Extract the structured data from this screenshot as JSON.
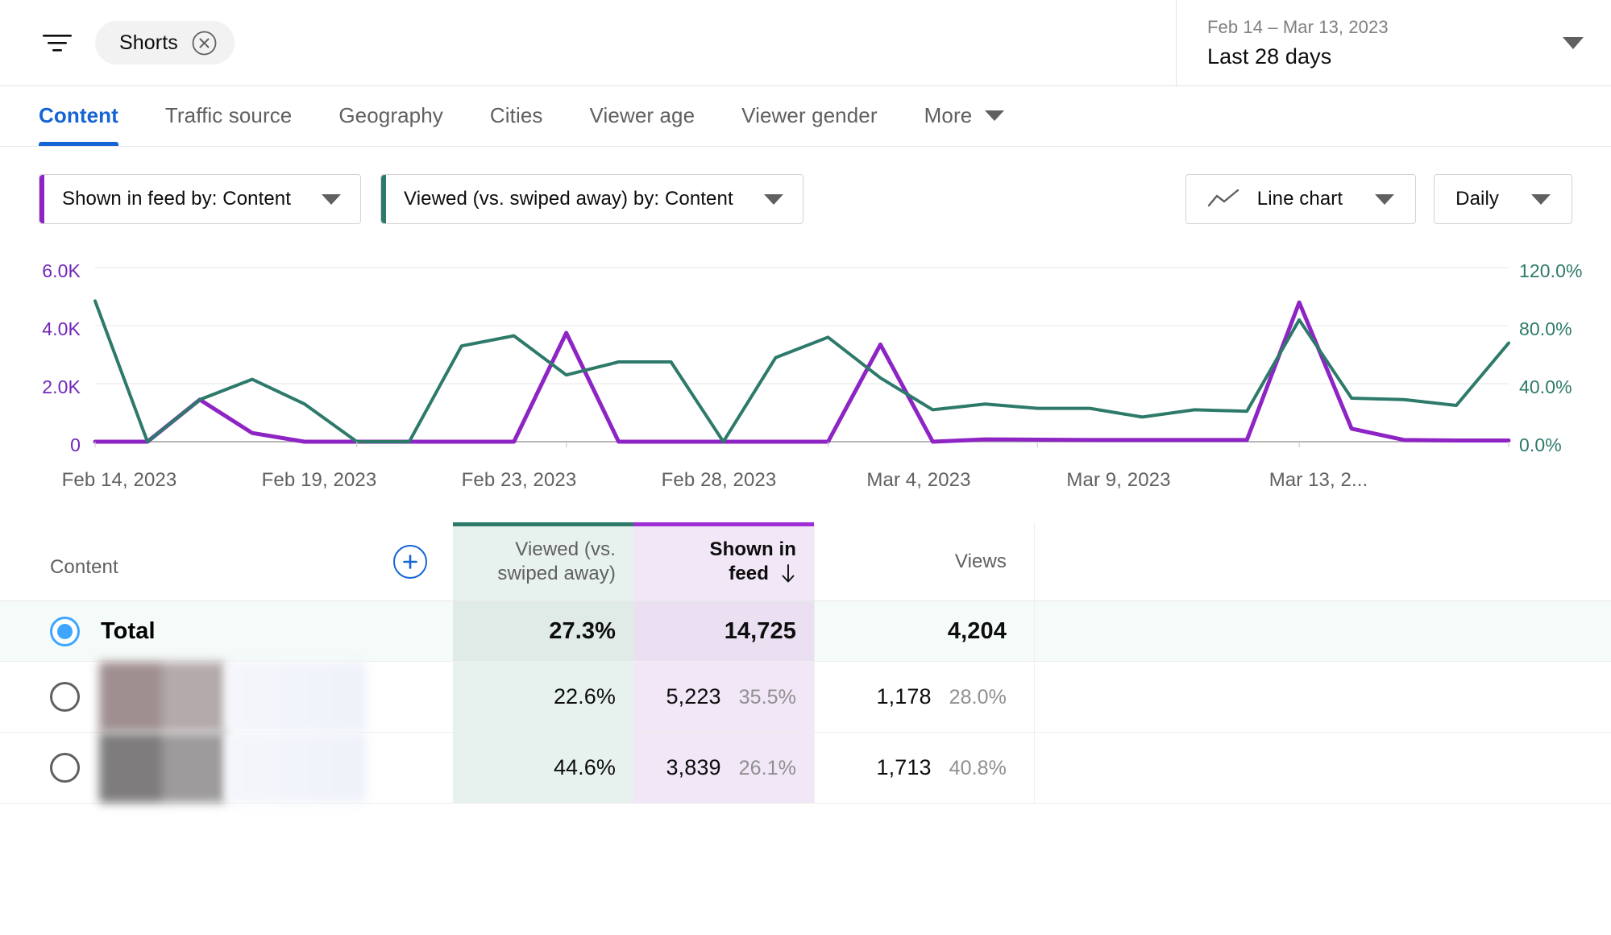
{
  "topbar": {
    "filter_icon": "filter-list-icon",
    "chip_label": "Shorts",
    "chip_close_icon": "close-circle-icon",
    "date_sub": "Feb 14 – Mar 13, 2023",
    "date_main": "Last 28 days",
    "date_caret_icon": "chevron-down-icon"
  },
  "tabs": [
    {
      "label": "Content",
      "active": true
    },
    {
      "label": "Traffic source",
      "active": false
    },
    {
      "label": "Geography",
      "active": false
    },
    {
      "label": "Cities",
      "active": false
    },
    {
      "label": "Viewer age",
      "active": false
    },
    {
      "label": "Viewer gender",
      "active": false
    }
  ],
  "tabs_more": {
    "label": "More",
    "icon": "chevron-down-icon"
  },
  "controls": {
    "metric_a": {
      "label": "Shown in feed by: Content",
      "accent": "#8e24c4"
    },
    "metric_b": {
      "label": "Viewed (vs. swiped away) by: Content",
      "accent": "#2d7a6a"
    },
    "chart_type": {
      "label": "Line chart",
      "icon": "line-chart-icon"
    },
    "granularity": {
      "label": "Daily"
    }
  },
  "chart_data": {
    "type": "line",
    "title": "",
    "xlabel": "",
    "grid": true,
    "legend": "none",
    "x": [
      "Feb 14, 2023",
      "Feb 15, 2023",
      "Feb 16, 2023",
      "Feb 17, 2023",
      "Feb 18, 2023",
      "Feb 19, 2023",
      "Feb 20, 2023",
      "Feb 21, 2023",
      "Feb 22, 2023",
      "Feb 23, 2023",
      "Feb 24, 2023",
      "Feb 25, 2023",
      "Feb 26, 2023",
      "Feb 27, 2023",
      "Feb 28, 2023",
      "Mar 1, 2023",
      "Mar 2, 2023",
      "Mar 3, 2023",
      "Mar 4, 2023",
      "Mar 5, 2023",
      "Mar 6, 2023",
      "Mar 7, 2023",
      "Mar 8, 2023",
      "Mar 9, 2023",
      "Mar 10, 2023",
      "Mar 11, 2023",
      "Mar 12, 2023",
      "Mar 13, 2023"
    ],
    "xtick_labels": [
      "Feb 14, 2023",
      "Feb 19, 2023",
      "Feb 23, 2023",
      "Feb 28, 2023",
      "Mar 4, 2023",
      "Mar 9, 2023",
      "Mar 13, 2..."
    ],
    "xtick_index": [
      0,
      5,
      9,
      14,
      18,
      23,
      27
    ],
    "axes": [
      {
        "side": "left",
        "name": "Shown in feed",
        "color": "#7226bb",
        "ticks": [
          "0",
          "2.0K",
          "4.0K",
          "6.0K"
        ],
        "tick_values": [
          0,
          2000,
          4000,
          6000
        ],
        "ylim": [
          0,
          6000
        ]
      },
      {
        "side": "right",
        "name": "Viewed (vs. swiped away)",
        "color": "#2d7a6a",
        "ticks": [
          "0.0%",
          "40.0%",
          "80.0%",
          "120.0%"
        ],
        "tick_values": [
          0,
          40,
          80,
          120
        ],
        "ylim": [
          0,
          120
        ]
      }
    ],
    "series": [
      {
        "name": "Shown in feed",
        "color": "#8e24c4",
        "axis": "left",
        "unit": "count",
        "values": [
          0,
          0,
          1450,
          300,
          0,
          0,
          0,
          0,
          0,
          3750,
          0,
          0,
          0,
          0,
          0,
          3350,
          0,
          80,
          70,
          60,
          60,
          60,
          60,
          4800,
          450,
          60,
          40,
          40
        ]
      },
      {
        "name": "Viewed (vs. swiped away)",
        "color": "#2d7a6a",
        "axis": "right",
        "unit": "percent",
        "values": [
          97,
          0,
          29,
          43,
          26,
          0,
          0,
          66,
          73,
          46,
          55,
          55,
          0,
          58,
          72,
          44,
          22,
          26,
          23,
          23,
          17,
          22,
          21,
          84,
          30,
          29,
          25,
          68
        ]
      }
    ]
  },
  "table": {
    "headers": {
      "content": "Content",
      "add_metric_icon": "plus-circle-icon",
      "viewed": "Viewed (vs.\nswiped away)",
      "viewed_line1": "Viewed (vs.",
      "viewed_line2": "swiped away)",
      "shown_line1": "Shown in",
      "shown_line2": "feed",
      "sort_icon": "arrow-down-icon",
      "views": "Views"
    },
    "rows": [
      {
        "type": "total",
        "label": "Total",
        "selected": true,
        "viewed": "27.3%",
        "shown": "14,725",
        "shown_pct": "",
        "views": "4,204",
        "views_pct": ""
      },
      {
        "type": "item",
        "label": "",
        "selected": false,
        "viewed": "22.6%",
        "shown": "5,223",
        "shown_pct": "35.5%",
        "views": "1,178",
        "views_pct": "28.0%",
        "thumb_colors": [
          "#a08f90",
          "#b4aaab",
          "#b8b2b0"
        ]
      },
      {
        "type": "item",
        "label": "",
        "selected": false,
        "viewed": "44.6%",
        "shown": "3,839",
        "shown_pct": "26.1%",
        "views": "1,713",
        "views_pct": "40.8%",
        "thumb_colors": [
          "#7e7c7c",
          "#9d9b9b",
          "#aeadad"
        ]
      }
    ]
  },
  "colors": {
    "accent_blue": "#1664d4",
    "purple": "#8e24c4",
    "teal": "#2d7a6a",
    "purple_tint": "#f1e7f7",
    "teal_tint": "#e7f1ee"
  }
}
